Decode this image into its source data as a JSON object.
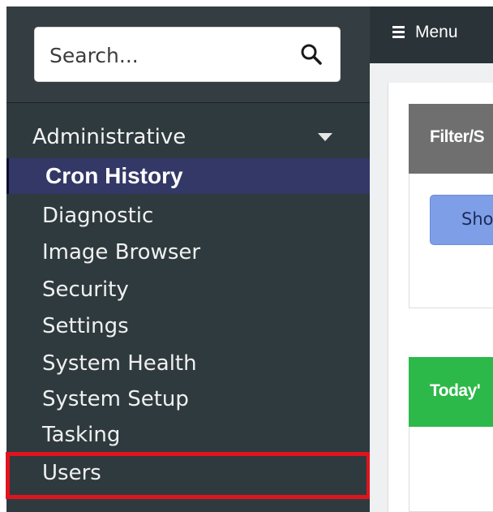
{
  "search": {
    "placeholder": "Search..."
  },
  "sidebar": {
    "group_label": "Administrative",
    "items": [
      {
        "label": "Cron History",
        "active": true
      },
      {
        "label": "Diagnostic"
      },
      {
        "label": "Image Browser"
      },
      {
        "label": "Security"
      },
      {
        "label": "Settings"
      },
      {
        "label": "System Health"
      },
      {
        "label": "System Setup"
      },
      {
        "label": "Tasking"
      },
      {
        "label": "Users",
        "highlighted": true
      }
    ]
  },
  "topbar": {
    "menu_label": "Menu"
  },
  "panels": {
    "filter": {
      "title": "Filter/S",
      "button_label": "Sho",
      "header_color": "#6f6f6f",
      "button_color": "#7e9fe8"
    },
    "today": {
      "title": "Today'",
      "header_color": "#2db84a"
    }
  },
  "colors": {
    "sidebar_bg": "#2f3a3f",
    "active_item_bg": "#333866",
    "highlight_outline": "#e0141e",
    "topbar_bg": "#2a3338"
  },
  "icons": {
    "search": "search-icon",
    "caret": "caret-down-icon",
    "hamburger": "hamburger-icon"
  }
}
